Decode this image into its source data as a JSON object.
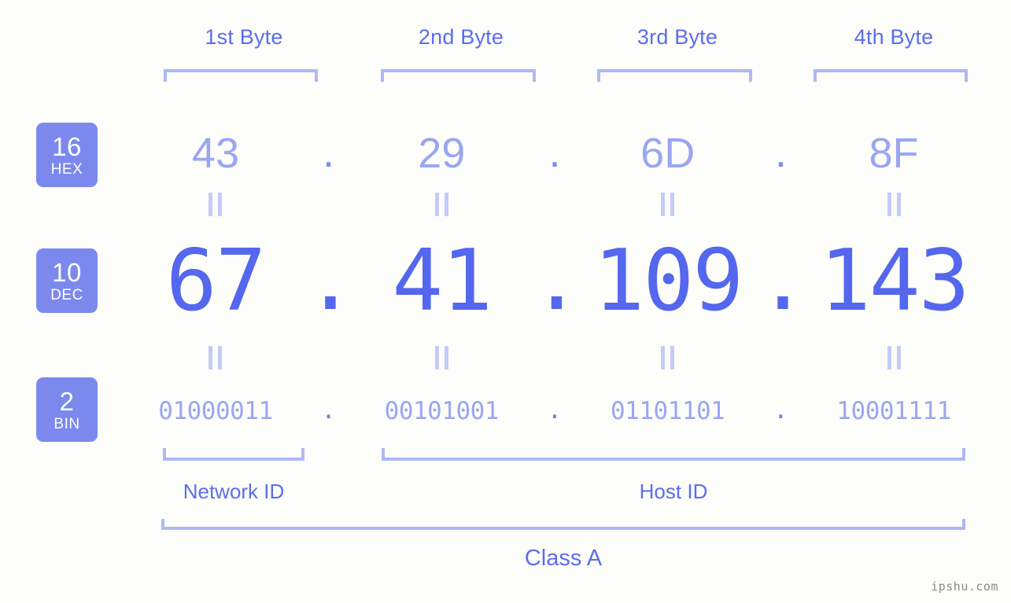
{
  "background_color": "#fdfefa",
  "colors": {
    "accent_strong": "#5467ee",
    "accent_label": "#5b6df0",
    "accent_light": "#9aa6f3",
    "bracket": "#aeb8f7",
    "badge_fill": "#7b89ef",
    "badge_text": "#ffffff",
    "watermark": "#8a8a8a"
  },
  "byte_headers": [
    {
      "label": "1st Byte"
    },
    {
      "label": "2nd Byte"
    },
    {
      "label": "3rd Byte"
    },
    {
      "label": "4th Byte"
    }
  ],
  "bases": [
    {
      "number": "16",
      "name": "HEX"
    },
    {
      "number": "10",
      "name": "DEC"
    },
    {
      "number": "2",
      "name": "BIN"
    }
  ],
  "separator": ".",
  "equality_mark": "||",
  "rows": {
    "hex": {
      "base_number": "16",
      "base_name": "HEX",
      "values": [
        "43",
        "29",
        "6D",
        "8F"
      ]
    },
    "dec": {
      "base_number": "10",
      "base_name": "DEC",
      "values": [
        "67",
        "41",
        "109",
        "143"
      ]
    },
    "bin": {
      "base_number": "2",
      "base_name": "BIN",
      "values": [
        "01000011",
        "00101001",
        "01101101",
        "10001111"
      ]
    }
  },
  "id_sections": [
    {
      "label": "Network ID",
      "bytes": 1
    },
    {
      "label": "Host ID",
      "bytes": 3
    }
  ],
  "class_row": {
    "label": "Class A"
  },
  "watermark": {
    "text": "ipshu.com"
  },
  "ip_address": {
    "dotted_decimal": "67.41.109.143",
    "hex": "43.29.6D.8F",
    "binary": "01000011.00101001.01101101.10001111"
  }
}
